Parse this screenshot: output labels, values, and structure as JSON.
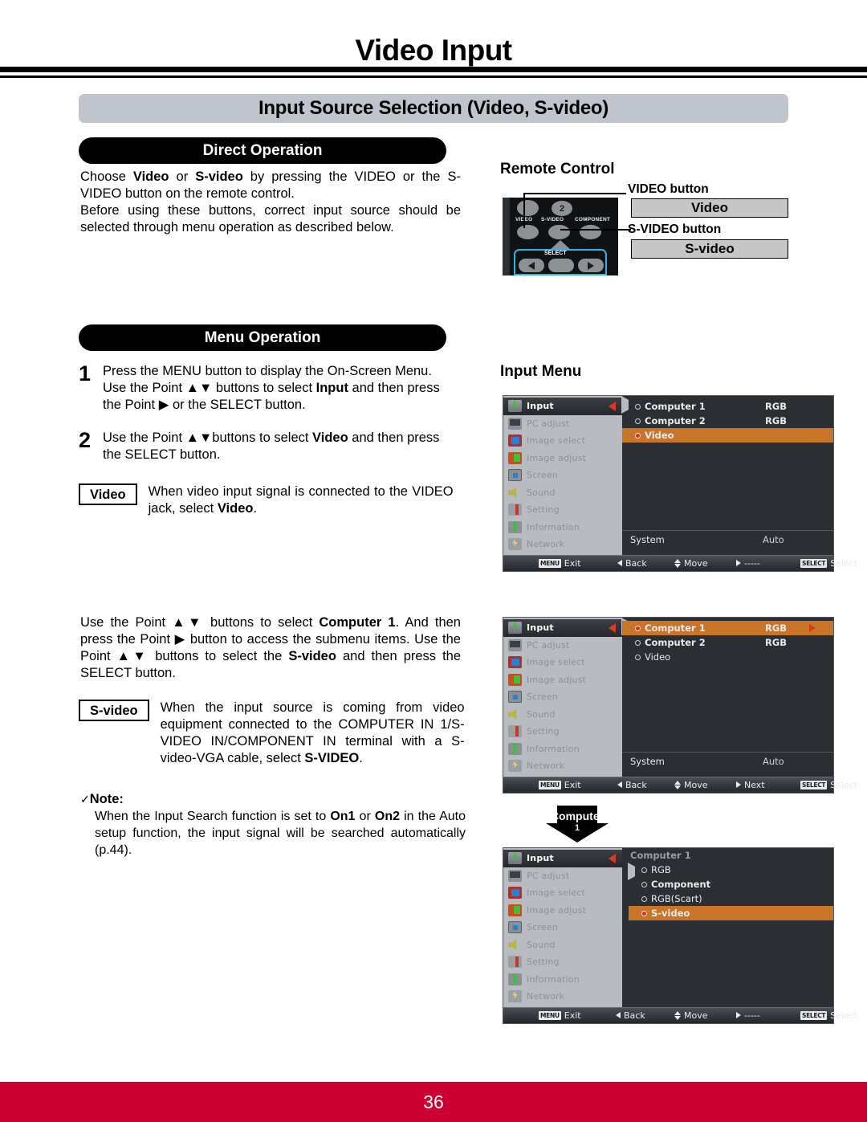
{
  "header": {
    "page_title": "Video Input",
    "section_title": "Input Source Selection (Video, S-video)"
  },
  "direct_operation": {
    "heading": "Direct Operation",
    "para1_a": "Choose ",
    "para1_b": "Video",
    "para1_c": " or ",
    "para1_d": "S-video",
    "para1_e": " by pressing the VIDEO or the S-VIDEO button on the remote control.",
    "para2": "Before using these buttons, correct input source should be selected through menu operation as described below."
  },
  "remote_control": {
    "title": "Remote Control",
    "video_button_label": "VIDEO button",
    "svideo_button_label": "S-VIDEO button",
    "video_box": "Video",
    "svideo_box": "S-video",
    "keys": {
      "video": "VIDEO",
      "svideo": "S-VIDEO",
      "component": "COMPONENT",
      "number": "2",
      "select": "SELECT"
    }
  },
  "menu_operation": {
    "heading": "Menu Operation",
    "steps": [
      {
        "number": "1",
        "text_a": "Press the MENU button to display the On-Screen Menu. Use the Point ▲▼ buttons to select ",
        "bold": "Input",
        "text_b": " and then press the Point ▶ or the SELECT button."
      },
      {
        "number": "2",
        "text_a": "Use the Point ▲▼buttons to select ",
        "bold": "Video",
        "text_b": " and then press the SELECT button."
      }
    ],
    "video_row": {
      "label": "Video",
      "text_a": "When video input signal is connected to the VIDEO jack, select ",
      "bold": "Video",
      "text_b": "."
    },
    "computer1_para": {
      "text_a": "Use the Point ▲▼ buttons to select ",
      "bold_a": "Computer 1",
      "text_b": ". And then press the Point ▶ button to access the submenu items. Use the Point ▲▼ buttons to select the ",
      "bold_b": "S-video",
      "text_c": " and then press the SELECT button."
    },
    "svideo_row": {
      "label": "S-video",
      "text_a": "When the input source is coming from video equipment connected to the COMPUTER IN 1/S-VIDEO IN/COMPONENT IN terminal with a S-video-VGA cable, select ",
      "bold": "S-VIDEO",
      "text_b": "."
    },
    "note": {
      "check": "✓",
      "heading": "Note:",
      "text_a": "When the Input Search function is set to ",
      "bold_a": "On1",
      "text_b": " or ",
      "bold_b": "On2",
      "text_c": " in the Auto setup function, the input signal will be searched automatically (p.44)."
    }
  },
  "input_menu": {
    "title": "Input Menu",
    "sidebar": [
      {
        "label": "Input",
        "icon": "input-icon"
      },
      {
        "label": "PC adjust",
        "icon": "pc-adjust-icon"
      },
      {
        "label": "Image select",
        "icon": "image-select-icon"
      },
      {
        "label": "Image adjust",
        "icon": "image-adjust-icon"
      },
      {
        "label": "Screen",
        "icon": "screen-icon"
      },
      {
        "label": "Sound",
        "icon": "sound-icon"
      },
      {
        "label": "Setting",
        "icon": "setting-icon"
      },
      {
        "label": "Information",
        "icon": "information-icon"
      },
      {
        "label": "Network",
        "icon": "network-icon"
      }
    ],
    "system_label": "System",
    "system_value": "Auto",
    "footer": {
      "menu_key": "MENU",
      "exit": "Exit",
      "back": "Back",
      "move": "Move",
      "next_dashes": "-----",
      "next": "Next",
      "select_key": "SELECT",
      "select": "Select"
    },
    "menu1": {
      "items": [
        {
          "label": "Computer 1",
          "value": "RGB",
          "selected": false
        },
        {
          "label": "Computer 2",
          "value": "RGB",
          "selected": false
        },
        {
          "label": "Video",
          "value": "",
          "selected": true
        }
      ]
    },
    "menu2": {
      "items": [
        {
          "label": "Computer 1",
          "value": "RGB",
          "selected": true
        },
        {
          "label": "Computer 2",
          "value": "RGB",
          "selected": false
        },
        {
          "label": "Video",
          "value": "",
          "selected": false
        }
      ]
    },
    "menu3": {
      "submenu_title": "Computer 1",
      "items": [
        {
          "label": "RGB",
          "selected": false
        },
        {
          "label": "Component",
          "selected": false
        },
        {
          "label": "RGB(Scart)",
          "selected": false
        },
        {
          "label": "S-video",
          "selected": true
        }
      ]
    },
    "callout": {
      "line1": "Computer",
      "line2": "1"
    }
  },
  "footer": {
    "page_number": "36"
  },
  "colors": {
    "footer_red": "#cc0033",
    "section_gray": "#c0c5cd",
    "osd_highlight_orange": "#c8752a",
    "osd_sidebar_gray": "#b8bcc0",
    "osd_panel_dark": "#2b2e33",
    "osd_arrow_red": "#d93b20"
  }
}
